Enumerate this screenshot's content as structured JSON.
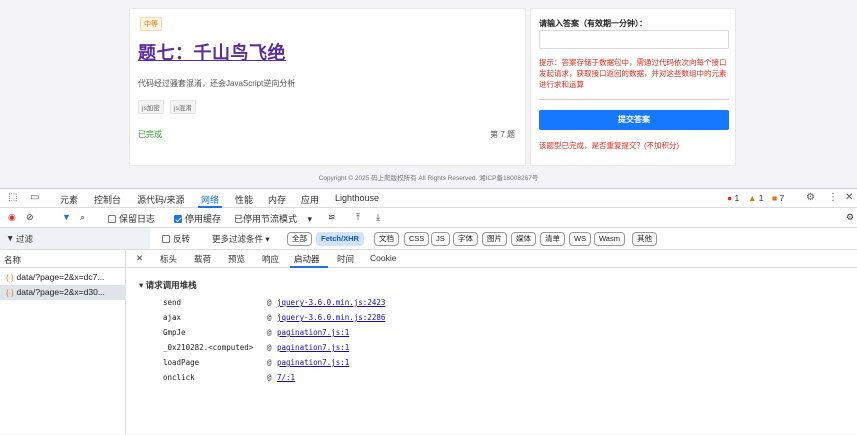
{
  "page": {
    "difficulty_badge": "中等",
    "title": "题七：千山鸟飞绝",
    "description": "代码经过骚套混淆，还会JavaScript逆向分析",
    "tags": [
      "js加密",
      "js混淆"
    ],
    "status": "已完成",
    "question_number": "第 7 题",
    "answer_label": "请输入答案（有效期一分钟）：",
    "answer_value": "",
    "hint": "提示：答案存储于数据包中，需通过代码依次向每个接口发起请求，获取接口返回的数据，并对这些数组中的元素进行求和运算",
    "submit_label": "提交答案",
    "done_message": "该题型已完成，是否重复提交？(不加积分)",
    "copyright": "Copyright © 2025 码上爬版权所有 All Rights Reserved. 湘ICP备18008267号"
  },
  "devtools": {
    "tabs": [
      "元素",
      "控制台",
      "源代码/来源",
      "网络",
      "性能",
      "内存",
      "应用",
      "Lighthouse"
    ],
    "active_tab": "网络",
    "status": {
      "errors": "1",
      "warnings": "1",
      "issues": "7"
    },
    "toolbar": {
      "preserve_log": "保留日志",
      "disable_cache": "停用缓存",
      "throttle": "已停用节流模式"
    },
    "filter": {
      "placeholder": "过滤",
      "invert": "反转",
      "more_filters": "更多过滤条件",
      "chips": [
        "全部",
        "Fetch/XHR",
        "文档",
        "CSS",
        "JS",
        "字体",
        "图片",
        "媒体",
        "清单",
        "WS",
        "Wasm",
        "其他"
      ],
      "active_chip": "Fetch/XHR"
    },
    "requests_header": "名称",
    "requests": [
      "data/?page=2&x=dc7...",
      "data/?page=2&x=d30..."
    ],
    "detail_tabs": [
      "标头",
      "载荷",
      "预览",
      "响应",
      "启动器",
      "时间",
      "Cookie"
    ],
    "active_detail_tab": "启动器",
    "stack_title": "请求调用堆栈",
    "stack": [
      {
        "fn": "send",
        "src": "jquery-3.6.0.min.js:2423"
      },
      {
        "fn": "ajax",
        "src": "jquery-3.6.0.min.js:2286"
      },
      {
        "fn": "GmpJe",
        "src": "pagination7.js:1"
      },
      {
        "fn": "_0x210282.<computed>",
        "src": "pagination7.js:1"
      },
      {
        "fn": "loadPage",
        "src": "pagination7.js:1"
      },
      {
        "fn": "onclick",
        "src": "7/:1"
      }
    ]
  }
}
